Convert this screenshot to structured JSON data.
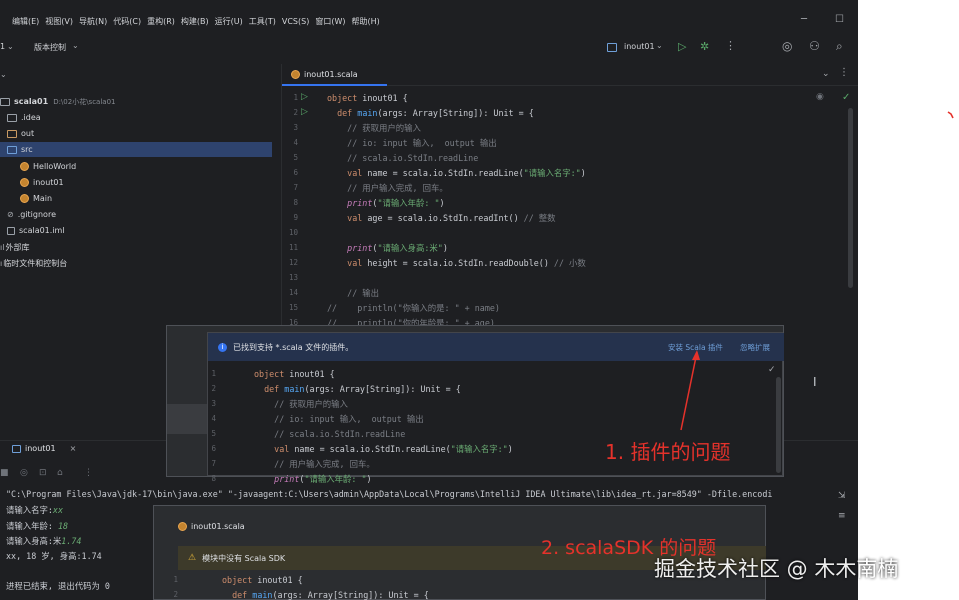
{
  "menu": [
    "编辑(E)",
    "视图(V)",
    "导航(N)",
    "代码(C)",
    "重构(R)",
    "构建(B)",
    "运行(U)",
    "工具(T)",
    "VCS(S)",
    "窗口(W)",
    "帮助(H)"
  ],
  "toolbar": {
    "project_num": "1",
    "vcs": "版本控制",
    "run_config": "inout01"
  },
  "project": {
    "root": "scala01",
    "root_path": "D:\\02小花\\scala01",
    "items": [
      ".idea",
      "out",
      "src",
      "HelloWorld",
      "inout01",
      "Main",
      ".gitignore",
      "scala01.iml",
      "外部库",
      "临时文件和控制台"
    ]
  },
  "editor": {
    "tab": "inout01.scala",
    "line_numbers": [
      "1",
      "2",
      "3",
      "4",
      "5",
      "6",
      "7",
      "8",
      "9",
      "10",
      "11",
      "12",
      "13",
      "14",
      "15",
      "16"
    ],
    "lines": [
      "object inout01 {",
      "  def main(args: Array[String]): Unit = {",
      "    // 获取用户的输入",
      "    // io: input 输入,  output 输出",
      "    // scala.io.StdIn.readLine",
      "    val name = scala.io.StdIn.readLine(\"请输入名字:\")",
      "    // 用户输入完成, 回车。",
      "    print(\"请输入年龄: \")",
      "    val age = scala.io.StdIn.readInt() // 整数",
      "",
      "    print(\"请输入身高:米\")",
      "    val height = scala.io.StdIn.readDouble() // 小数",
      "",
      "    // 输出",
      "//    println(\"你输入的是: \" + name)",
      "//    println(\"你的年龄是: \" + age)"
    ]
  },
  "popup": {
    "banner": "已找到支持 *.scala 文件的插件。",
    "install": "安装 Scala 插件",
    "ignore": "忽略扩展",
    "line_numbers": [
      "1",
      "2",
      "3",
      "4",
      "5",
      "6",
      "7",
      "8"
    ],
    "lines": [
      "object inout01 {",
      "  def main(args: Array[String]): Unit = {",
      "    // 获取用户的输入",
      "    // io: input 输入,  output 输出",
      "    // scala.io.StdIn.readLine",
      "    val name = scala.io.StdIn.readLine(\"请输入名字:\")",
      "    // 用户输入完成, 回车。",
      "    print(\"请输入年龄: \")"
    ]
  },
  "annotations": {
    "a1": "1. 插件的问题",
    "a2": "2. scalaSDK 的问题",
    "watermark": "掘金技术社区 @ 木木南楠"
  },
  "run": {
    "tab": "inout01",
    "cmd": "\"C:\\Program Files\\Java\\jdk-17\\bin\\java.exe\" \"-javaagent:C:\\Users\\admin\\AppData\\Local\\Programs\\IntelliJ IDEA Ultimate\\lib\\idea_rt.jar=8549\" -Dfile.encodi",
    "o1": "请输入名字:",
    "o1v": "xx",
    "o2": "请输入年龄: ",
    "o2v": "18",
    "o3": "请输入身高:米",
    "o3v": "1.74",
    "o4": "xx, 18 岁, 身高:1.74",
    "o5": "进程已结束, 退出代码为 0"
  },
  "popup2": {
    "tab": "inout01.scala",
    "warning": "模块中没有 Scala SDK",
    "line_numbers": [
      "1",
      "2"
    ],
    "lines": [
      "object inout01 {",
      "  def main(args: Array[String]): Unit = {"
    ]
  },
  "colors": {
    "annotation_red": "#e5322b",
    "accent": "#3574f0"
  }
}
